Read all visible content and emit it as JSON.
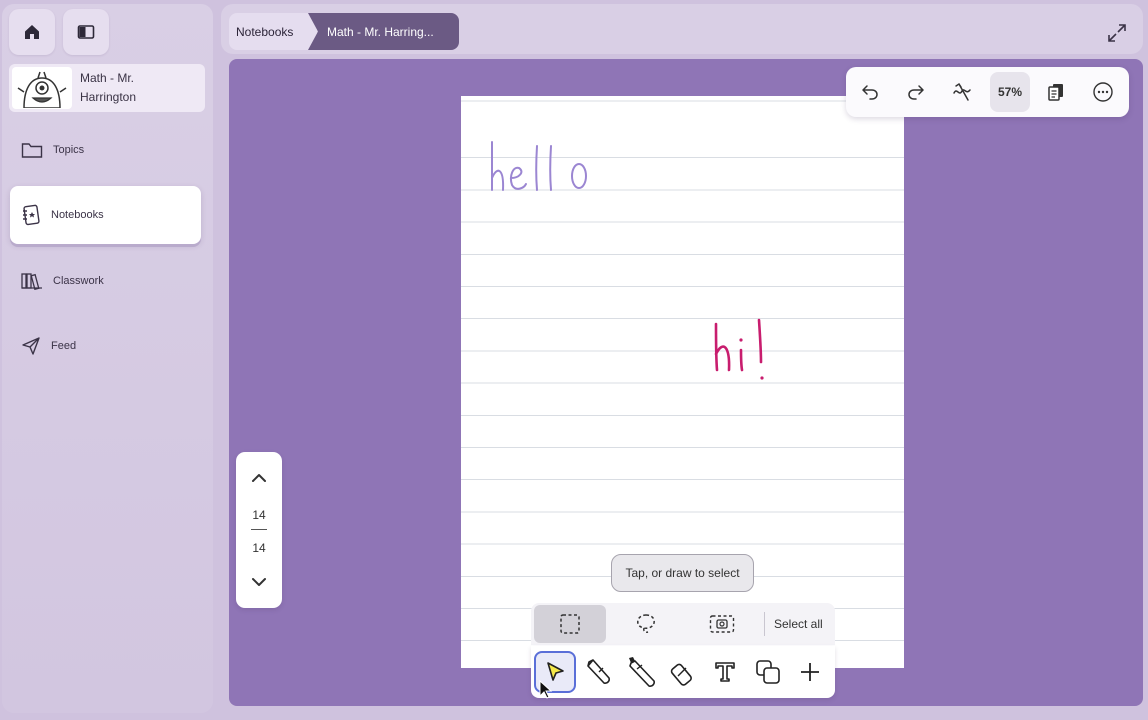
{
  "sidebar": {
    "profile_name": "Math - Mr. Harrington",
    "items": [
      {
        "label": "Topics",
        "icon": "folder-icon"
      },
      {
        "label": "Notebooks",
        "icon": "notebook-icon",
        "active": true
      },
      {
        "label": "Classwork",
        "icon": "books-icon"
      },
      {
        "label": "Feed",
        "icon": "send-icon"
      }
    ]
  },
  "breadcrumb": {
    "root": "Notebooks",
    "current": "Math - Mr. Harring..."
  },
  "canvas_toolbar": {
    "zoom": "57%",
    "icons": [
      "undo-icon",
      "redo-icon",
      "gesture-icon",
      "pages-icon",
      "more-icon"
    ]
  },
  "page_nav": {
    "current": "14",
    "total": "14"
  },
  "notebook": {
    "ink_text_1": "hello",
    "ink_text_2": "hi!",
    "ink_colors": {
      "hello": "#9b86d2",
      "hi": "#c81d6e"
    }
  },
  "selection": {
    "hint": "Tap, or draw to select",
    "select_all": "Select all",
    "modes": [
      "rectangle-select-icon",
      "lasso-select-icon",
      "screenshot-select-icon"
    ]
  },
  "tools": [
    "select-tool-icon",
    "pen-icon",
    "highlighter-icon",
    "eraser-icon",
    "text-icon",
    "shapes-icon",
    "add-icon"
  ],
  "colors": {
    "canvas_bg": "#8f75b6",
    "accent": "#6b5a84",
    "active_tool_border": "#5a6fd8"
  }
}
